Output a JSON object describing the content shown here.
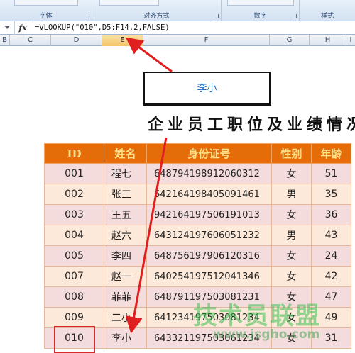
{
  "ribbon": {
    "groups": [
      "字体",
      "对齐方式",
      "数字",
      "样式"
    ]
  },
  "formula_bar": {
    "fx_label": "fx",
    "formula": "=VLOOKUP(\"010\",D5:F14,2,FALSE)"
  },
  "columns": [
    "B",
    "C",
    "D",
    "E",
    "F",
    "G",
    "H",
    "I"
  ],
  "selected_column": "E",
  "popup_value": "李小",
  "sheet_title": "企业员工职位及业绩情况",
  "table": {
    "headers": [
      "ID",
      "姓名",
      "身份证号",
      "性别",
      "年龄"
    ],
    "rows": [
      [
        "001",
        "程七",
        "648794198912060312",
        "女",
        "51"
      ],
      [
        "002",
        "张三",
        "642164198405091461",
        "男",
        "35"
      ],
      [
        "003",
        "王五",
        "942164197506191013",
        "女",
        "36"
      ],
      [
        "004",
        "赵六",
        "643124197606051232",
        "男",
        "43"
      ],
      [
        "005",
        "李四",
        "648756197906120316",
        "女",
        "24"
      ],
      [
        "007",
        "赵一",
        "640254197512041346",
        "女",
        "42"
      ],
      [
        "008",
        "菲菲",
        "648791197503081231",
        "女",
        "47"
      ],
      [
        "009",
        "二小",
        "641234197503081234",
        "女",
        "49"
      ],
      [
        "010",
        "李小",
        "643321197503061234",
        "女",
        "31"
      ]
    ]
  },
  "accent_colors": {
    "header_bg": "#e46d0a",
    "header_text": "#ffe08a",
    "annotation": "#d62b2b"
  },
  "watermark": {
    "text": "技术员联盟",
    "url": "www.jsgho.com"
  }
}
